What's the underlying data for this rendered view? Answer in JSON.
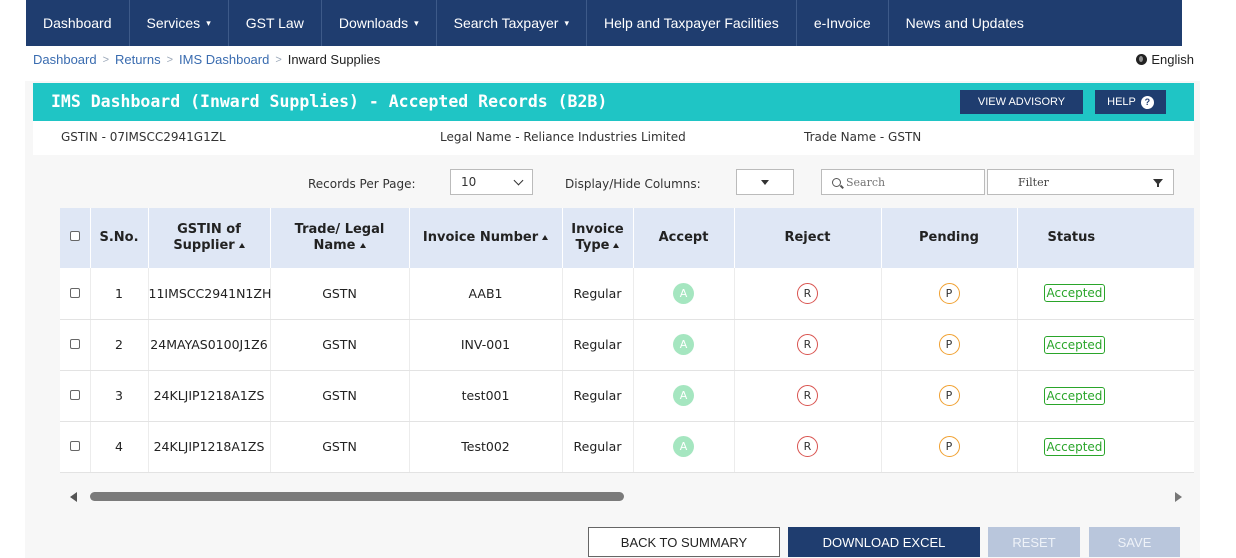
{
  "nav": {
    "items": [
      {
        "label": "Dashboard",
        "dropdown": false
      },
      {
        "label": "Services",
        "dropdown": true
      },
      {
        "label": "GST Law",
        "dropdown": false
      },
      {
        "label": "Downloads",
        "dropdown": true
      },
      {
        "label": "Search Taxpayer",
        "dropdown": true
      },
      {
        "label": "Help and Taxpayer Facilities",
        "dropdown": false
      },
      {
        "label": "e-Invoice",
        "dropdown": false
      },
      {
        "label": "News and Updates",
        "dropdown": false
      }
    ]
  },
  "breadcrumb": {
    "items": [
      "Dashboard",
      "Returns",
      "IMS Dashboard"
    ],
    "current": "Inward Supplies",
    "separator": ">"
  },
  "language": "English",
  "panel": {
    "title": "IMS Dashboard (Inward Supplies) - Accepted Records (B2B)",
    "view_advisory": "VIEW ADVISORY",
    "help": "HELP",
    "help_icon": "?"
  },
  "info": {
    "gstin": "GSTIN - 07IMSCC2941G1ZL",
    "legal_name": "Legal Name - Reliance Industries Limited",
    "trade_name": "Trade Name - GSTN"
  },
  "controls": {
    "records_per_page_label": "Records Per Page:",
    "records_per_page_value": "10",
    "display_hide_label": "Display/Hide Columns:",
    "search_placeholder": "Search",
    "filter_label": "Filter"
  },
  "table": {
    "headers": {
      "sno": "S.No.",
      "gstin_line1": "GSTIN of",
      "gstin_line2": "Supplier",
      "trade_line1": "Trade/ Legal",
      "trade_line2": "Name",
      "invoice_number": "Invoice Number",
      "invoice_type_line1": "Invoice",
      "invoice_type_line2": "Type",
      "accept": "Accept",
      "reject": "Reject",
      "pending": "Pending",
      "status": "Status"
    },
    "action_letters": {
      "accept": "A",
      "reject": "R",
      "pending": "P"
    },
    "rows": [
      {
        "sno": "1",
        "gstin": "11IMSCC2941N1ZH",
        "trade_name": "GSTN",
        "invoice_number": "AAB1",
        "invoice_type": "Regular",
        "status": "Accepted"
      },
      {
        "sno": "2",
        "gstin": "24MAYAS0100J1Z6",
        "trade_name": "GSTN",
        "invoice_number": "INV-001",
        "invoice_type": "Regular",
        "status": "Accepted"
      },
      {
        "sno": "3",
        "gstin": "24KLJIP1218A1ZS",
        "trade_name": "GSTN",
        "invoice_number": "test001",
        "invoice_type": "Regular",
        "status": "Accepted"
      },
      {
        "sno": "4",
        "gstin": "24KLJIP1218A1ZS",
        "trade_name": "GSTN",
        "invoice_number": "Test002",
        "invoice_type": "Regular",
        "status": "Accepted"
      }
    ]
  },
  "footer": {
    "back": "BACK TO SUMMARY",
    "download": "DOWNLOAD EXCEL",
    "reset": "RESET",
    "save": "SAVE"
  },
  "colors": {
    "nav_bg": "#1f3d6f",
    "panel_header": "#1fc5c5",
    "table_header_bg": "#dfe7f5",
    "accept": "#a5e6c0",
    "reject": "#d9534f",
    "pending": "#f0a030",
    "status_accepted": "#2aa52a"
  }
}
